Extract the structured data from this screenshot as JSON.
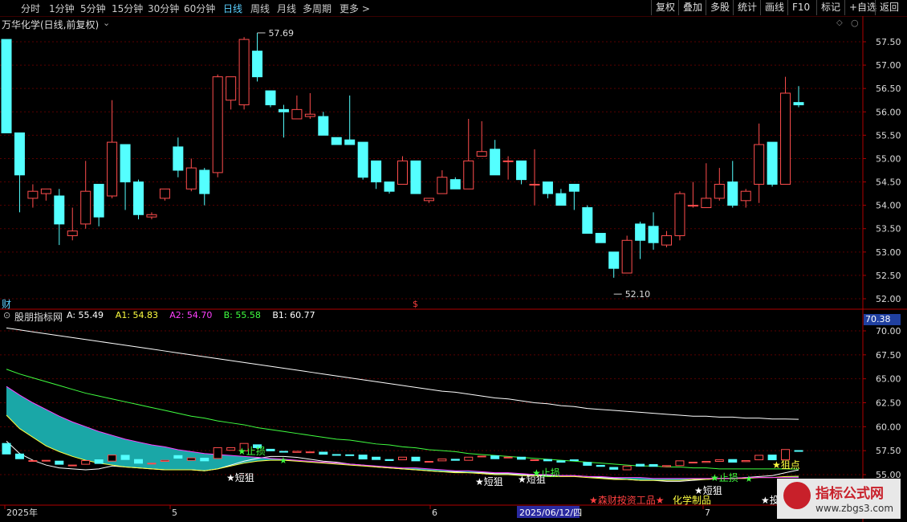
{
  "toolbar": {
    "periods": [
      "分时",
      "1分钟",
      "5分钟",
      "15分钟",
      "30分钟",
      "60分钟",
      "日线",
      "周线",
      "月线",
      "多周期",
      "更多 >"
    ],
    "active": "日线",
    "buttons": [
      "复权",
      "叠加",
      "多股",
      "统计",
      "画线",
      "F10",
      "标记",
      "+自选",
      "返回"
    ]
  },
  "main": {
    "title": "万华化学(日线,前复权)",
    "y_ticks": [
      "57.50",
      "57.00",
      "56.50",
      "56.00",
      "55.50",
      "55.00",
      "54.50",
      "54.00",
      "53.50",
      "53.00",
      "52.50",
      "52.00"
    ],
    "high_label": "57.69",
    "low_label": "52.10",
    "bottom_left": "财",
    "bottom_mid": "$"
  },
  "indicator": {
    "name": "股朋指标网",
    "values": [
      {
        "label": "A: 55.49",
        "color": "#ffffff"
      },
      {
        "label": "A1: 54.83",
        "color": "#ffff40"
      },
      {
        "label": "A2: 54.70",
        "color": "#ff40ff"
      },
      {
        "label": "B: 55.58",
        "color": "#40ff40"
      },
      {
        "label": "B1: 60.77",
        "color": "#ffffff"
      }
    ],
    "current": "70.38",
    "y_ticks": [
      "70.00",
      "67.50",
      "65.00",
      "62.50",
      "60.00",
      "57.50",
      "55.00"
    ],
    "signals": [
      "短狙",
      "止损",
      "短狙",
      "短狙",
      "止损",
      "短狙",
      "止损",
      "狙点",
      "★森财按资工品★",
      "化学制品",
      "★投"
    ]
  },
  "xaxis": {
    "labels": [
      "2025年",
      "5",
      "6",
      "2025/06/12/四",
      "7"
    ]
  },
  "watermark": {
    "line1": "指标公式网",
    "line2": "www.zbgs3.com"
  },
  "chart_data": {
    "type": "candlestick",
    "title": "万华化学(日线,前复权)",
    "ylim": [
      51.9,
      57.8
    ],
    "candles": [
      {
        "o": 57.55,
        "h": 57.55,
        "l": 55.55,
        "c": 55.55
      },
      {
        "o": 55.55,
        "h": 55.55,
        "l": 53.85,
        "c": 54.65
      },
      {
        "o": 54.15,
        "h": 54.45,
        "l": 53.95,
        "c": 54.3
      },
      {
        "o": 54.25,
        "h": 54.35,
        "l": 54.1,
        "c": 54.35
      },
      {
        "o": 54.2,
        "h": 54.35,
        "l": 53.15,
        "c": 53.6
      },
      {
        "o": 53.35,
        "h": 53.95,
        "l": 53.25,
        "c": 53.45
      },
      {
        "o": 53.6,
        "h": 54.95,
        "l": 53.5,
        "c": 54.3
      },
      {
        "o": 54.45,
        "h": 54.45,
        "l": 53.55,
        "c": 53.75
      },
      {
        "o": 54.2,
        "h": 56.25,
        "l": 54.15,
        "c": 55.35
      },
      {
        "o": 55.3,
        "h": 55.3,
        "l": 53.9,
        "c": 54.5
      },
      {
        "o": 54.5,
        "h": 54.55,
        "l": 53.7,
        "c": 53.8
      },
      {
        "o": 53.75,
        "h": 53.85,
        "l": 53.7,
        "c": 53.8
      },
      {
        "o": 54.15,
        "h": 54.35,
        "l": 54.1,
        "c": 54.35
      },
      {
        "o": 55.25,
        "h": 55.45,
        "l": 54.6,
        "c": 54.75
      },
      {
        "o": 54.35,
        "h": 55.0,
        "l": 54.3,
        "c": 54.8
      },
      {
        "o": 54.75,
        "h": 54.8,
        "l": 54.0,
        "c": 54.25
      },
      {
        "o": 54.7,
        "h": 56.8,
        "l": 54.6,
        "c": 56.75
      },
      {
        "o": 56.25,
        "h": 56.35,
        "l": 56.05,
        "c": 56.75
      },
      {
        "o": 56.15,
        "h": 57.6,
        "l": 56.05,
        "c": 57.55
      },
      {
        "o": 57.3,
        "h": 57.69,
        "l": 56.65,
        "c": 56.75
      },
      {
        "o": 56.45,
        "h": 56.45,
        "l": 56.1,
        "c": 56.15
      },
      {
        "o": 56.05,
        "h": 56.15,
        "l": 55.45,
        "c": 56.0
      },
      {
        "o": 55.85,
        "h": 56.35,
        "l": 55.85,
        "c": 56.05
      },
      {
        "o": 55.9,
        "h": 56.4,
        "l": 55.85,
        "c": 55.95
      },
      {
        "o": 55.9,
        "h": 56.0,
        "l": 55.55,
        "c": 55.5
      },
      {
        "o": 55.45,
        "h": 55.45,
        "l": 55.3,
        "c": 55.3
      },
      {
        "o": 55.4,
        "h": 56.35,
        "l": 55.35,
        "c": 55.3
      },
      {
        "o": 55.35,
        "h": 55.35,
        "l": 54.55,
        "c": 54.6
      },
      {
        "o": 54.95,
        "h": 54.95,
        "l": 54.35,
        "c": 54.5
      },
      {
        "o": 54.5,
        "h": 54.5,
        "l": 54.25,
        "c": 54.3
      },
      {
        "o": 54.45,
        "h": 55.05,
        "l": 54.45,
        "c": 54.95
      },
      {
        "o": 54.95,
        "h": 54.95,
        "l": 54.25,
        "c": 54.25
      },
      {
        "o": 54.1,
        "h": 54.15,
        "l": 54.05,
        "c": 54.15
      },
      {
        "o": 54.25,
        "h": 54.75,
        "l": 54.25,
        "c": 54.6
      },
      {
        "o": 54.55,
        "h": 54.6,
        "l": 54.35,
        "c": 54.35
      },
      {
        "o": 54.35,
        "h": 55.85,
        "l": 54.35,
        "c": 54.95
      },
      {
        "o": 55.05,
        "h": 55.8,
        "l": 55.05,
        "c": 55.15
      },
      {
        "o": 55.2,
        "h": 55.4,
        "l": 54.7,
        "c": 54.65
      },
      {
        "o": 54.95,
        "h": 55.05,
        "l": 54.55,
        "c": 54.95
      },
      {
        "o": 54.95,
        "h": 54.95,
        "l": 54.45,
        "c": 54.55
      },
      {
        "o": 54.45,
        "h": 55.2,
        "l": 54.0,
        "c": 54.45
      },
      {
        "o": 54.5,
        "h": 54.5,
        "l": 54.15,
        "c": 54.25
      },
      {
        "o": 54.25,
        "h": 54.35,
        "l": 54.1,
        "c": 54.0
      },
      {
        "o": 54.45,
        "h": 54.45,
        "l": 53.9,
        "c": 54.3
      },
      {
        "o": 53.95,
        "h": 54.0,
        "l": 53.4,
        "c": 53.4
      },
      {
        "o": 53.4,
        "h": 53.4,
        "l": 53.2,
        "c": 53.2
      },
      {
        "o": 53.0,
        "h": 53.0,
        "l": 52.45,
        "c": 52.65
      },
      {
        "o": 52.55,
        "h": 53.35,
        "l": 52.55,
        "c": 53.25
      },
      {
        "o": 53.6,
        "h": 53.65,
        "l": 52.85,
        "c": 53.25
      },
      {
        "o": 53.55,
        "h": 53.85,
        "l": 53.05,
        "c": 53.2
      },
      {
        "o": 53.15,
        "h": 53.45,
        "l": 53.1,
        "c": 53.35
      },
      {
        "o": 53.35,
        "h": 54.3,
        "l": 53.25,
        "c": 54.25
      },
      {
        "o": 54.0,
        "h": 54.5,
        "l": 53.95,
        "c": 54.0
      },
      {
        "o": 53.95,
        "h": 54.9,
        "l": 53.95,
        "c": 54.15
      },
      {
        "o": 54.15,
        "h": 54.8,
        "l": 54.1,
        "c": 54.45
      },
      {
        "o": 54.5,
        "h": 54.95,
        "l": 53.95,
        "c": 54.0
      },
      {
        "o": 54.1,
        "h": 54.35,
        "l": 53.95,
        "c": 54.3
      },
      {
        "o": 54.45,
        "h": 55.75,
        "l": 54.05,
        "c": 55.3
      },
      {
        "o": 55.35,
        "h": 55.35,
        "l": 54.4,
        "c": 54.45
      },
      {
        "o": 54.45,
        "h": 56.75,
        "l": 54.45,
        "c": 56.4
      },
      {
        "o": 56.2,
        "h": 56.55,
        "l": 56.1,
        "c": 56.15
      }
    ],
    "series": [
      {
        "name": "A",
        "color": "#ffffff",
        "values": [
          58.5,
          57.2,
          56.5,
          56.0,
          55.7,
          55.6,
          55.5,
          55.6,
          55.9,
          55.8,
          55.7,
          55.6,
          55.5,
          55.5,
          55.5,
          55.4,
          55.6,
          56.0,
          56.4,
          56.7,
          56.9,
          56.9,
          56.8,
          56.6,
          56.4,
          56.3,
          56.1,
          56.0,
          55.8,
          55.7,
          55.6,
          55.5,
          55.4,
          55.3,
          55.3,
          55.2,
          55.2,
          55.1,
          55.1,
          55.0,
          55.0,
          54.9,
          54.9,
          54.9,
          54.8,
          54.7,
          54.6,
          54.5,
          54.4,
          54.4,
          54.3,
          54.3,
          54.4,
          54.5,
          54.6,
          54.6,
          54.7,
          54.8,
          54.9,
          55.2,
          55.49
        ]
      },
      {
        "name": "A1",
        "color": "#ffff40",
        "values": [
          61.2,
          59.8,
          58.9,
          58.0,
          57.4,
          56.9,
          56.5,
          56.2,
          56.0,
          55.8,
          55.7,
          55.6,
          55.5,
          55.5,
          55.5,
          55.4,
          55.6,
          55.9,
          56.2,
          56.4,
          56.5,
          56.5,
          56.4,
          56.3,
          56.2,
          56.1,
          56.0,
          55.9,
          55.8,
          55.7,
          55.6,
          55.5,
          55.4,
          55.3,
          55.2,
          55.2,
          55.1,
          55.0,
          55.0,
          54.9,
          54.9,
          54.8,
          54.8,
          54.8,
          54.7,
          54.6,
          54.5,
          54.5,
          54.4,
          54.4,
          54.4,
          54.4,
          54.5,
          54.5,
          54.6,
          54.6,
          54.6,
          54.7,
          54.7,
          54.8,
          54.83
        ]
      },
      {
        "name": "A2",
        "color": "#ff40ff",
        "values": [
          64.2,
          63.3,
          62.5,
          61.8,
          61.1,
          60.5,
          60.0,
          59.5,
          59.1,
          58.7,
          58.4,
          58.1,
          57.9,
          57.6,
          57.4,
          57.2,
          57.1,
          57.0,
          56.9,
          56.8,
          56.7,
          56.6,
          56.5,
          56.4,
          56.3,
          56.2,
          56.1,
          56.0,
          55.9,
          55.8,
          55.7,
          55.7,
          55.6,
          55.5,
          55.4,
          55.4,
          55.3,
          55.2,
          55.2,
          55.1,
          55.0,
          55.0,
          54.9,
          54.9,
          54.8,
          54.8,
          54.7,
          54.7,
          54.7,
          54.6,
          54.6,
          54.6,
          54.6,
          54.6,
          54.6,
          54.6,
          54.7,
          54.7,
          54.7,
          54.7,
          54.7
        ]
      },
      {
        "name": "B",
        "color": "#40ff40",
        "values": [
          66.0,
          65.5,
          65.1,
          64.7,
          64.3,
          63.9,
          63.5,
          63.2,
          62.9,
          62.6,
          62.3,
          62.0,
          61.7,
          61.4,
          61.1,
          60.9,
          60.6,
          60.4,
          60.2,
          59.9,
          59.7,
          59.5,
          59.3,
          59.1,
          58.9,
          58.7,
          58.6,
          58.4,
          58.2,
          58.1,
          57.9,
          57.8,
          57.6,
          57.5,
          57.4,
          57.2,
          57.1,
          57.0,
          56.9,
          56.8,
          56.7,
          56.6,
          56.5,
          56.4,
          56.3,
          56.2,
          56.1,
          56.0,
          55.9,
          55.9,
          55.8,
          55.8,
          55.7,
          55.7,
          55.6,
          55.6,
          55.6,
          55.6,
          55.6,
          55.6,
          55.58
        ]
      },
      {
        "name": "B1",
        "color": "#ffffff",
        "values": [
          70.3,
          70.1,
          69.9,
          69.7,
          69.5,
          69.3,
          69.1,
          68.9,
          68.7,
          68.5,
          68.3,
          68.1,
          67.9,
          67.7,
          67.5,
          67.3,
          67.1,
          66.9,
          66.7,
          66.5,
          66.3,
          66.1,
          65.9,
          65.7,
          65.5,
          65.3,
          65.1,
          64.9,
          64.7,
          64.5,
          64.3,
          64.1,
          63.9,
          63.7,
          63.6,
          63.4,
          63.2,
          63.0,
          62.9,
          62.7,
          62.5,
          62.4,
          62.2,
          62.1,
          61.9,
          61.8,
          61.7,
          61.6,
          61.5,
          61.4,
          61.3,
          61.2,
          61.1,
          61.1,
          61.0,
          61.0,
          60.9,
          60.9,
          60.8,
          60.8,
          60.77
        ]
      }
    ]
  }
}
